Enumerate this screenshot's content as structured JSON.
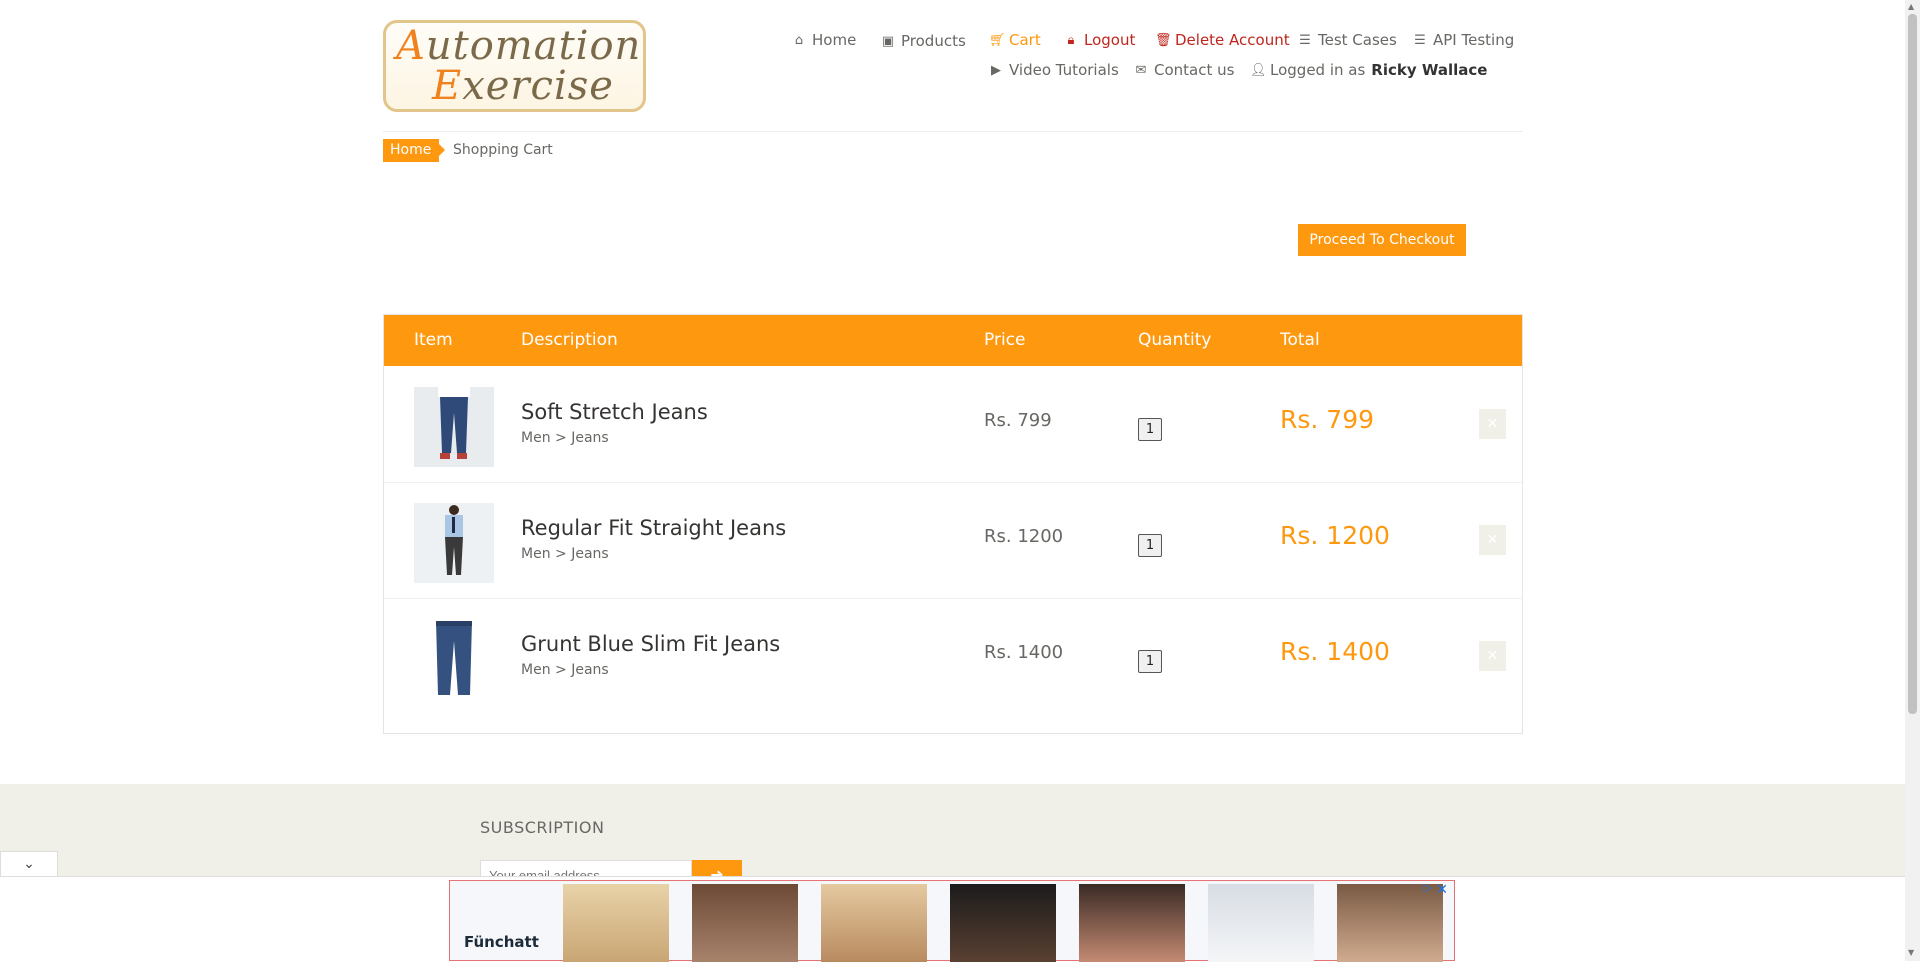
{
  "logo": {
    "line1_cap": "A",
    "line1_rest": "utomation",
    "line2_cap": "E",
    "line2_rest": "xercise"
  },
  "nav": {
    "home": "Home",
    "products": "Products",
    "cart": "Cart",
    "logout": "Logout",
    "delete_account": "Delete Account",
    "test_cases": "Test Cases",
    "api_testing": "API Testing",
    "video_tutorials": "Video Tutorials",
    "contact_us": "Contact us",
    "logged_in_prefix": "Logged in as",
    "user_name": "Ricky Wallace"
  },
  "breadcrumb": {
    "home": "Home",
    "current": "Shopping Cart"
  },
  "checkout_button": "Proceed To Checkout",
  "cart": {
    "headers": {
      "item": "Item",
      "description": "Description",
      "price": "Price",
      "quantity": "Quantity",
      "total": "Total"
    },
    "rows": [
      {
        "name": "Soft Stretch Jeans",
        "category": "Men > Jeans",
        "price": "Rs. 799",
        "quantity": "1",
        "total": "Rs. 799"
      },
      {
        "name": "Regular Fit Straight Jeans",
        "category": "Men > Jeans",
        "price": "Rs. 1200",
        "quantity": "1",
        "total": "Rs. 1200"
      },
      {
        "name": "Grunt Blue Slim Fit Jeans",
        "category": "Men > Jeans",
        "price": "Rs. 1400",
        "quantity": "1",
        "total": "Rs. 1400"
      }
    ]
  },
  "footer": {
    "subscription_title": "SUBSCRIPTION",
    "email_placeholder": "Your email address"
  },
  "ad": {
    "brand": "Fünchatt"
  },
  "colors": {
    "accent": "#fe980f",
    "danger": "#c0261d",
    "footer_bg": "#f0f0e9"
  }
}
